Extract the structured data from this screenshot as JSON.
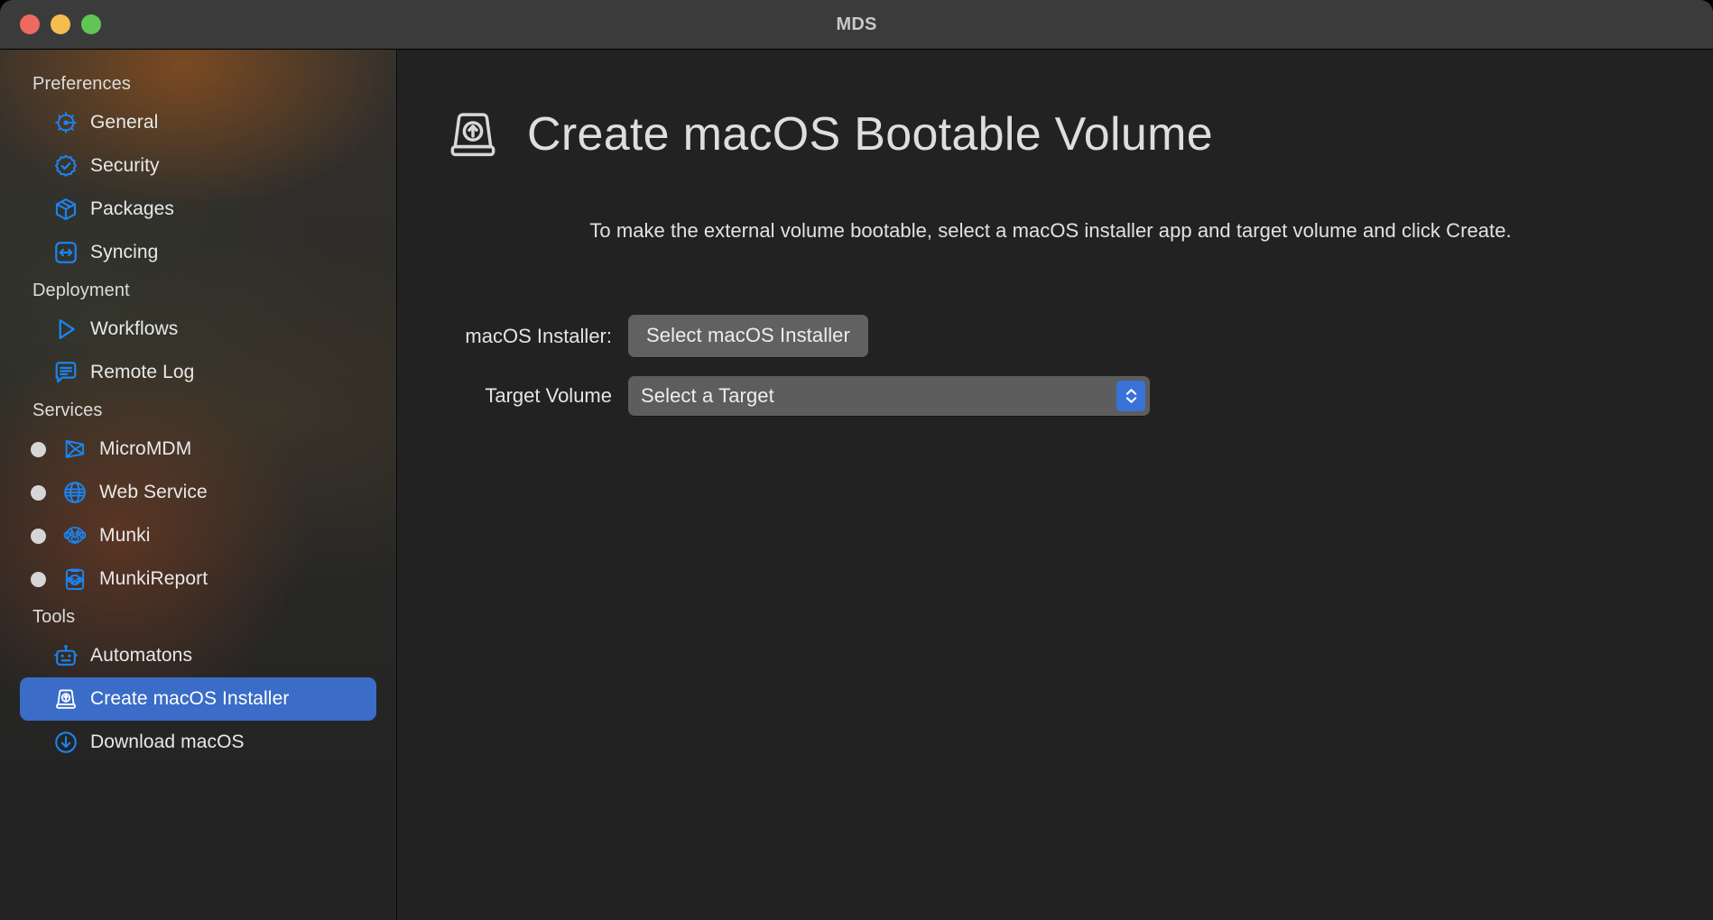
{
  "window": {
    "title": "MDS",
    "traffic_lights": [
      "close",
      "minimize",
      "maximize"
    ]
  },
  "sidebar": {
    "groups": [
      {
        "header": "Preferences",
        "items": [
          {
            "label": "General",
            "icon": "gear-icon",
            "selected": false,
            "has_status_dot": false
          },
          {
            "label": "Security",
            "icon": "checkmark-seal-icon",
            "selected": false,
            "has_status_dot": false
          },
          {
            "label": "Packages",
            "icon": "box-icon",
            "selected": false,
            "has_status_dot": false
          },
          {
            "label": "Syncing",
            "icon": "arrows-sync-icon",
            "selected": false,
            "has_status_dot": false
          }
        ]
      },
      {
        "header": "Deployment",
        "items": [
          {
            "label": "Workflows",
            "icon": "play-triangle-icon",
            "selected": false,
            "has_status_dot": false
          },
          {
            "label": "Remote Log",
            "icon": "speech-bubble-icon",
            "selected": false,
            "has_status_dot": false
          }
        ]
      },
      {
        "header": "Services",
        "items": [
          {
            "label": "MicroMDM",
            "icon": "micromdm-icon",
            "selected": false,
            "has_status_dot": true,
            "status": "stopped"
          },
          {
            "label": "Web Service",
            "icon": "globe-icon",
            "selected": false,
            "has_status_dot": true,
            "status": "stopped"
          },
          {
            "label": "Munki",
            "icon": "munki-monkey-icon",
            "selected": false,
            "has_status_dot": true,
            "status": "stopped"
          },
          {
            "label": "MunkiReport",
            "icon": "clipboard-monkey-icon",
            "selected": false,
            "has_status_dot": true,
            "status": "stopped"
          }
        ]
      },
      {
        "header": "Tools",
        "items": [
          {
            "label": "Automatons",
            "icon": "robot-icon",
            "selected": false,
            "has_status_dot": false
          },
          {
            "label": "Create macOS Installer",
            "icon": "external-drive-up-icon",
            "selected": true,
            "has_status_dot": false
          },
          {
            "label": "Download macOS",
            "icon": "download-circle-icon",
            "selected": false,
            "has_status_dot": false
          }
        ]
      }
    ]
  },
  "main": {
    "icon": "external-drive-up-icon",
    "title": "Create macOS Bootable Volume",
    "instructions": "To make the external volume bootable, select a macOS installer app and target volume and click Create.",
    "form": {
      "installer": {
        "label": "macOS Installer:",
        "button_label": "Select macOS Installer"
      },
      "target": {
        "label": "Target Volume",
        "selected_option": "Select a Target",
        "options": [
          "Select a Target"
        ]
      }
    }
  },
  "colors": {
    "accent_blue": "#0a84ff",
    "selection_blue": "#3a6cc8",
    "stepper_blue": "#3a73d8",
    "sidebar_bg": "#2a2a28",
    "main_bg": "#222222",
    "titlebar_bg": "#3b3b3b",
    "control_gray": "#5d5d5d",
    "status_dot_gray": "#d6d6d6"
  }
}
